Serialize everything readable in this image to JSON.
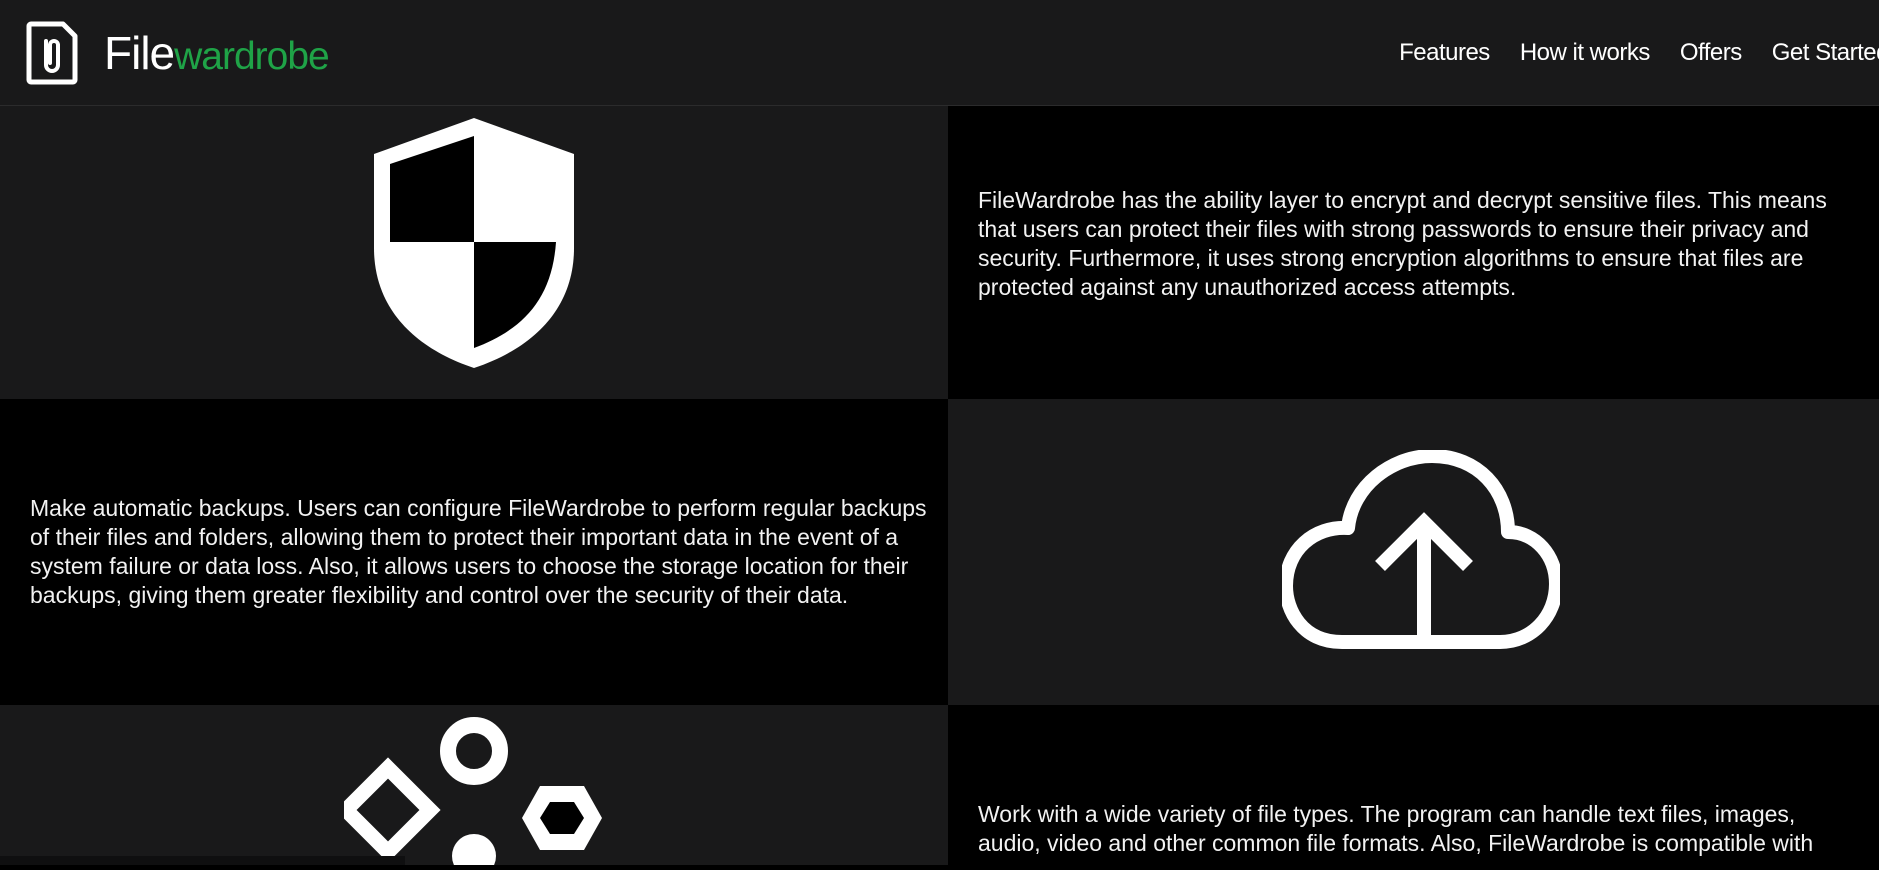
{
  "header": {
    "logo": {
      "icon": "file-clip-icon",
      "name_part1": "File",
      "name_part2": "wardrobe",
      "accent_color": "#1fa347"
    },
    "nav": [
      {
        "label": "Features"
      },
      {
        "label": "How it works"
      },
      {
        "label": "Offers"
      },
      {
        "label": "Get Started"
      }
    ]
  },
  "features": [
    {
      "icon": "shield-icon",
      "text": "FileWardrobe has the ability layer to encrypt and decrypt sensitive files. This means that users can protect their files with strong passwords to ensure their privacy and security. Furthermore, it uses strong encryption algorithms to ensure that files are protected against any unauthorized access attempts."
    },
    {
      "icon": "cloud-upload-icon",
      "text": "Make automatic backups. Users can configure FileWardrobe to perform regular backups of their files and folders, allowing them to protect their important data in the event of a system failure or data loss. Also, it allows users to choose the storage location for their backups, giving them greater flexibility and control over the security of their data."
    },
    {
      "icon": "file-types-shapes-icon",
      "text": "Work with a wide variety of file types. The program can handle text files, images, audio, video and other common file formats. Also, FileWardrobe is compatible with"
    }
  ],
  "colors": {
    "background_dark": "#19191a",
    "background_black": "#000000",
    "text": "#ffffff"
  }
}
